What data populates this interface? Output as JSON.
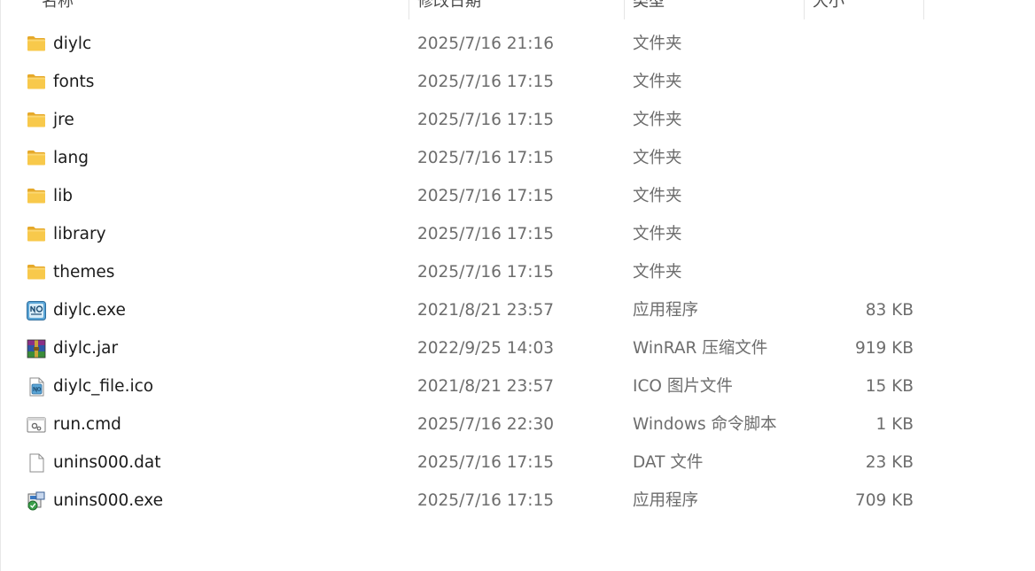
{
  "columns": {
    "name": "名称",
    "date": "修改日期",
    "type": "类型",
    "size": "大小"
  },
  "files": [
    {
      "name": "diylc",
      "date": "2025/7/16 21:16",
      "type": "文件夹",
      "size": "",
      "icon": "folder-icon"
    },
    {
      "name": "fonts",
      "date": "2025/7/16 17:15",
      "type": "文件夹",
      "size": "",
      "icon": "folder-icon"
    },
    {
      "name": "jre",
      "date": "2025/7/16 17:15",
      "type": "文件夹",
      "size": "",
      "icon": "folder-icon"
    },
    {
      "name": "lang",
      "date": "2025/7/16 17:15",
      "type": "文件夹",
      "size": "",
      "icon": "folder-icon"
    },
    {
      "name": "lib",
      "date": "2025/7/16 17:15",
      "type": "文件夹",
      "size": "",
      "icon": "folder-icon"
    },
    {
      "name": "library",
      "date": "2025/7/16 17:15",
      "type": "文件夹",
      "size": "",
      "icon": "folder-icon"
    },
    {
      "name": "themes",
      "date": "2025/7/16 17:15",
      "type": "文件夹",
      "size": "",
      "icon": "folder-icon"
    },
    {
      "name": "diylc.exe",
      "date": "2021/8/21 23:57",
      "type": "应用程序",
      "size": "83 KB",
      "icon": "diylc-app-icon"
    },
    {
      "name": "diylc.jar",
      "date": "2022/9/25 14:03",
      "type": "WinRAR 压缩文件",
      "size": "919 KB",
      "icon": "winrar-archive-icon"
    },
    {
      "name": "diylc_file.ico",
      "date": "2021/8/21 23:57",
      "type": "ICO 图片文件",
      "size": "15 KB",
      "icon": "ico-file-icon"
    },
    {
      "name": "run.cmd",
      "date": "2025/7/16 22:30",
      "type": "Windows 命令脚本",
      "size": "1 KB",
      "icon": "cmd-script-icon"
    },
    {
      "name": "unins000.dat",
      "date": "2025/7/16 17:15",
      "type": "DAT 文件",
      "size": "23 KB",
      "icon": "blank-file-icon"
    },
    {
      "name": "unins000.exe",
      "date": "2025/7/16 17:15",
      "type": "应用程序",
      "size": "709 KB",
      "icon": "installer-icon"
    }
  ],
  "colors": {
    "folder": "#f8c94b",
    "folder_dark": "#e6a92a",
    "secondary_text": "#6d6d6d",
    "primary_text": "#1b1b1b"
  }
}
